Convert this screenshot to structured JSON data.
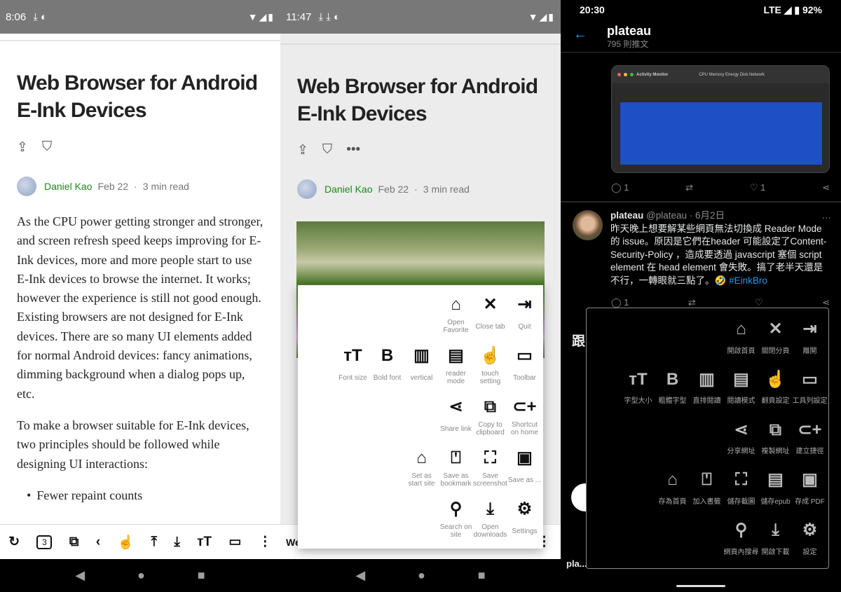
{
  "left": {
    "status": {
      "time": "8:06",
      "icons": "⤓ ◐",
      "right": "▼◢▮"
    },
    "article": {
      "title": "Web Browser for Android E-Ink Devices",
      "author": "Daniel Kao",
      "date": "Feb 22",
      "read_time": "3 min read",
      "paragraphs": [
        "As the CPU power getting stronger and stronger, and screen refresh speed keeps improving for E-Ink devices, more and more people start to use E-Ink devices to browse the internet. It works; however the experience is still not good enough. Existing browsers are not designed for E-Ink devices. There are so many UI elements added for normal Android devices: fancy animations, dimming background when a dialog pops up, etc.",
        "To make a browser suitable for E-Ink devices, two principles should be followed while designing UI interactions:"
      ],
      "bullets": [
        "Fewer repaint counts"
      ]
    },
    "toolbar": {
      "tab_count": "3"
    }
  },
  "middle": {
    "status": {
      "time": "11:47",
      "icons": "⤓ ⤓ ◐",
      "right": "▼◢▮"
    },
    "article": {
      "title": "Web Browser for Android E-Ink Devices",
      "author": "Daniel Kao",
      "date": "Feb 22",
      "read_time": "3 min read"
    },
    "toolbar_text": "We",
    "menu": [
      [
        {
          "icon": "home",
          "g": "⌂",
          "label": "Open\nFavorite"
        },
        {
          "icon": "close",
          "g": "✕",
          "label": "Close tab"
        },
        {
          "icon": "exit",
          "g": "⇥",
          "label": "Quit"
        }
      ],
      [
        {
          "icon": "font-size",
          "g": "ᴛT",
          "label": "Font size"
        },
        {
          "icon": "bold",
          "g": "B",
          "label": "Bold font"
        },
        {
          "icon": "vertical",
          "g": "▥",
          "label": "vertical"
        },
        {
          "icon": "book",
          "g": "▤",
          "label": "reader\nmode"
        },
        {
          "icon": "touch",
          "g": "☝",
          "label": "touch\nsetting"
        },
        {
          "icon": "ruler",
          "g": "▭",
          "label": "Toolbar"
        }
      ],
      [
        {
          "icon": "share",
          "g": "⋖",
          "label": "Share link"
        },
        {
          "icon": "copy",
          "g": "⧉",
          "label": "Copy to\nclipboard"
        },
        {
          "icon": "add-link",
          "g": "⊂+",
          "label": "Shortcut\non home"
        }
      ],
      [
        {
          "icon": "home",
          "g": "⌂",
          "label": "Set as\nstart site"
        },
        {
          "icon": "bookmark-add",
          "g": "⍞",
          "label": "Save as\nbookmark"
        },
        {
          "icon": "screenshot",
          "g": "⛶",
          "label": "Save\nscreenshot"
        },
        {
          "icon": "pdf",
          "g": "▣",
          "label": "Save as ..."
        }
      ],
      [
        {
          "icon": "search",
          "g": "⚲",
          "label": "Search on\nsite"
        },
        {
          "icon": "download",
          "g": "⤓",
          "label": "Open\ndownloads"
        },
        {
          "icon": "settings",
          "g": "⚙",
          "label": "Settings"
        }
      ]
    ]
  },
  "right": {
    "status": {
      "time": "20:30",
      "right": "LTE ◢ ▮ 92%"
    },
    "header": {
      "title": "plateau",
      "subtitle": "795 則推文"
    },
    "screenshot": {
      "app": "Activity Monitor",
      "tabs": "CPU  Memory  Energy  Disk  Network"
    },
    "tweet1_actions": {
      "replies": "1",
      "likes": "1"
    },
    "tweet2": {
      "name": "plateau",
      "handle": "@plateau · 6月2日",
      "text": "昨天晚上想要解某些網頁無法切換成 Reader Mode 的 issue。原因是它們在header 可能設定了Content-Security-Policy ，造成要透過 javascript 塞個 script element 在 head element 會失敗。搞了老半天還是不行，一轉眼就三點了。🤣 ",
      "hashtag": "#EinkBro",
      "replies": "1"
    },
    "bg_fragments": {
      "heading": "跟",
      "bottom": "pla..."
    },
    "menu": [
      [
        {
          "icon": "home",
          "g": "⌂",
          "label": "開啟首頁"
        },
        {
          "icon": "close",
          "g": "✕",
          "label": "關閉分頁"
        },
        {
          "icon": "exit",
          "g": "⇥",
          "label": "離開"
        }
      ],
      [
        {
          "icon": "font-size",
          "g": "ᴛT",
          "label": "字型大小"
        },
        {
          "icon": "bold",
          "g": "B",
          "label": "粗體字型"
        },
        {
          "icon": "vertical",
          "g": "▥",
          "label": "直排閱讀"
        },
        {
          "icon": "book",
          "g": "▤",
          "label": "閱讀模式"
        },
        {
          "icon": "touch",
          "g": "☝",
          "label": "翻頁設定"
        },
        {
          "icon": "ruler",
          "g": "▭",
          "label": "工具列設定"
        }
      ],
      [
        {
          "icon": "share",
          "g": "⋖",
          "label": "分享網址"
        },
        {
          "icon": "copy",
          "g": "⧉",
          "label": "複製網址"
        },
        {
          "icon": "add-link",
          "g": "⊂+",
          "label": "建立捷徑"
        }
      ],
      [
        {
          "icon": "home",
          "g": "⌂",
          "label": "存為首頁"
        },
        {
          "icon": "bookmark-add",
          "g": "⍞",
          "label": "加入書籤"
        },
        {
          "icon": "screenshot",
          "g": "⛶",
          "label": "儲存截圖"
        },
        {
          "icon": "epub",
          "g": "▤",
          "label": "儲存epub"
        },
        {
          "icon": "pdf",
          "g": "▣",
          "label": "存成 PDF"
        }
      ],
      [
        {
          "icon": "search",
          "g": "⚲",
          "label": "網頁內搜尋"
        },
        {
          "icon": "download",
          "g": "⤓",
          "label": "開啟下載"
        },
        {
          "icon": "settings",
          "g": "⚙",
          "label": "設定"
        }
      ]
    ]
  }
}
